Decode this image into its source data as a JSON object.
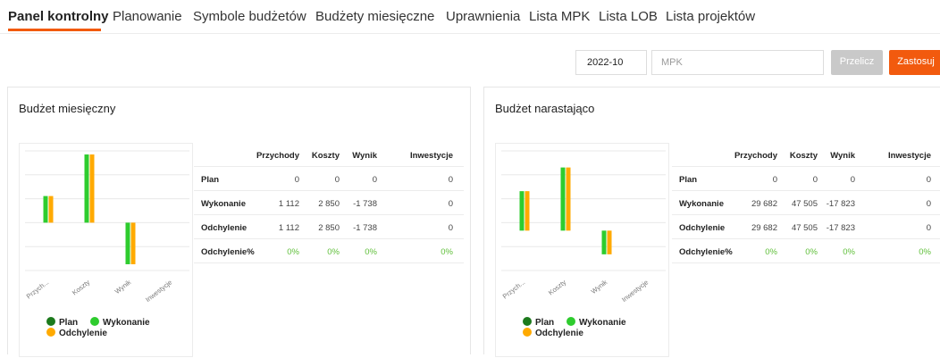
{
  "tabs": [
    {
      "label": "Panel kontrolny",
      "active": true
    },
    {
      "label": "Planowanie"
    },
    {
      "label": "Symbole budżetów"
    },
    {
      "label": "Budżety miesięczne"
    },
    {
      "label": "Uprawnienia"
    },
    {
      "label": "Lista MPK"
    },
    {
      "label": "Lista LOB"
    },
    {
      "label": "Lista projektów"
    }
  ],
  "toolbar": {
    "date_value": "2022-10",
    "mpk_placeholder": "MPK",
    "recalc_label": "Przelicz",
    "apply_label": "Zastosuj"
  },
  "colors": {
    "accent": "#f25a0e",
    "plan": "#1c7a1c",
    "wykonanie": "#2ecc2e",
    "odchylenie": "#ffaa00",
    "positive_pct": "#5fbf3a"
  },
  "legend": {
    "plan": "Plan",
    "wykonanie": "Wykonanie",
    "odchylenie": "Odchylenie"
  },
  "columns": [
    "Przychody",
    "Koszty",
    "Wynik",
    "Inwestycje"
  ],
  "row_labels": [
    "Plan",
    "Wykonanie",
    "Odchylenie",
    "Odchylenie%"
  ],
  "cards": [
    {
      "title": "Budżet miesięczny",
      "rows": [
        [
          "0",
          "0",
          "0",
          "0"
        ],
        [
          "1 112",
          "2 850",
          "-1 738",
          "0"
        ],
        [
          "1 112",
          "2 850",
          "-1 738",
          "0"
        ],
        [
          "0%",
          "0%",
          "0%",
          "0%"
        ]
      ]
    },
    {
      "title": "Budżet narastająco",
      "rows": [
        [
          "0",
          "0",
          "0",
          "0"
        ],
        [
          "29 682",
          "47 505",
          "-17 823",
          "0"
        ],
        [
          "29 682",
          "47 505",
          "-17 823",
          "0"
        ],
        [
          "0%",
          "0%",
          "0%",
          "0%"
        ]
      ]
    }
  ],
  "chart_data": [
    {
      "type": "bar",
      "categories": [
        "Przych...",
        "Koszty",
        "Wynik",
        "Inwestycje"
      ],
      "series": [
        {
          "name": "Plan",
          "values": [
            0,
            0,
            0,
            0
          ]
        },
        {
          "name": "Wykonanie",
          "values": [
            1112,
            2850,
            -1738,
            0
          ]
        },
        {
          "name": "Odchylenie",
          "values": [
            1112,
            2850,
            -1738,
            0
          ]
        }
      ],
      "ylim": [
        -2000,
        3000
      ],
      "grid": true,
      "legend": "bottom"
    },
    {
      "type": "bar",
      "categories": [
        "Przych...",
        "Koszty",
        "Wynik",
        "Inwestycje"
      ],
      "series": [
        {
          "name": "Plan",
          "values": [
            0,
            0,
            0,
            0
          ]
        },
        {
          "name": "Wykonanie",
          "values": [
            29682,
            47505,
            -17823,
            0
          ]
        },
        {
          "name": "Odchylenie",
          "values": [
            29682,
            47505,
            -17823,
            0
          ]
        }
      ],
      "ylim": [
        -30000,
        60000
      ],
      "grid": true,
      "legend": "bottom"
    }
  ]
}
